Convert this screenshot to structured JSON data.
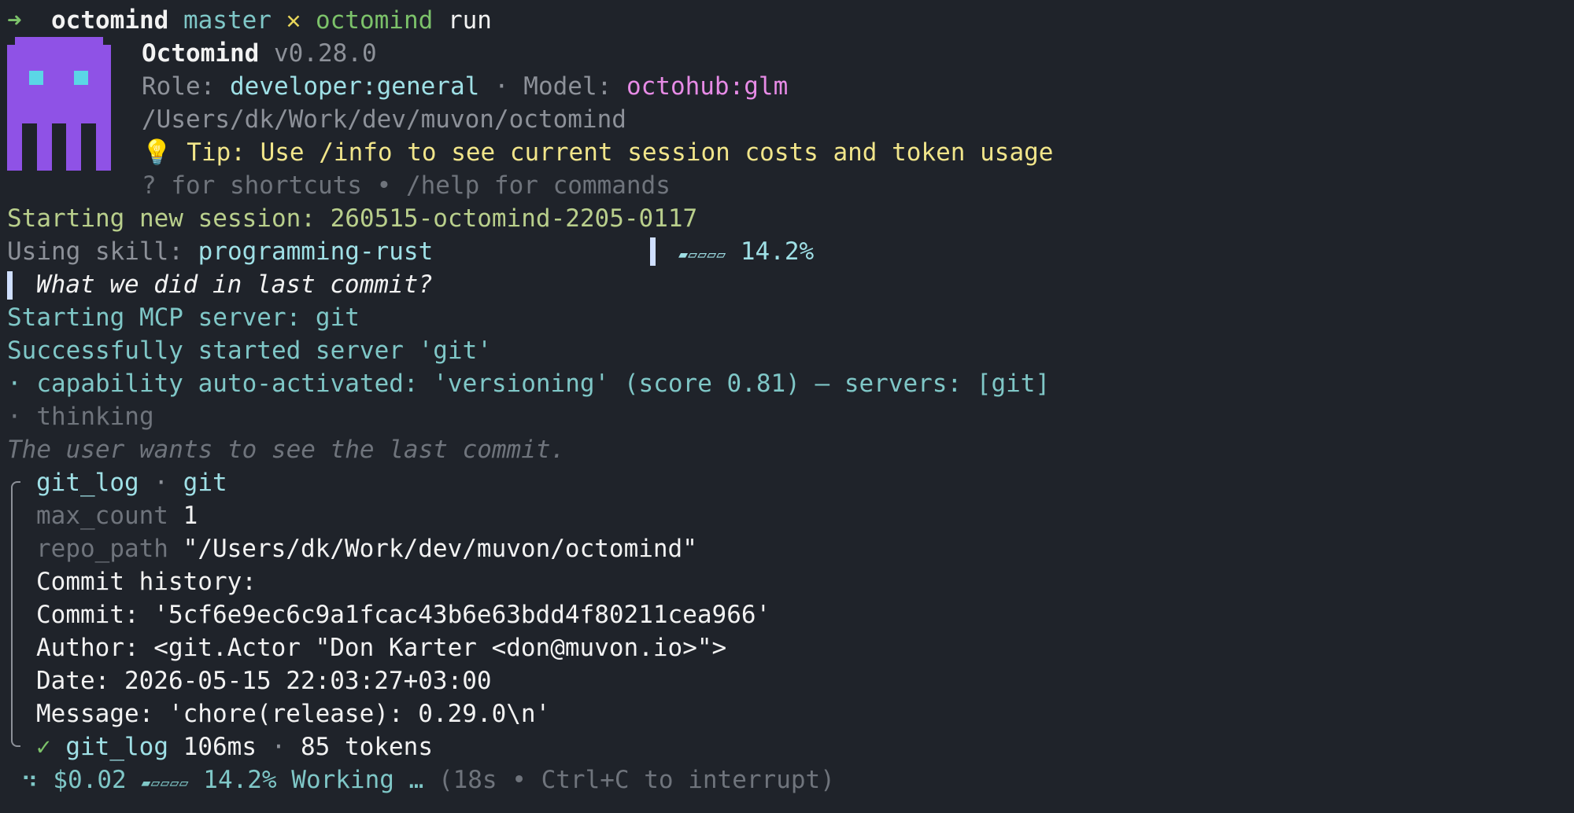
{
  "prompt": {
    "arrow": "➜",
    "cwd": "octomind",
    "branch": "master",
    "dirty": "✕",
    "command": "octomind",
    "arg": "run"
  },
  "header": {
    "app_name": "Octomind",
    "version": "v0.28.0",
    "role_label": "Role:",
    "role_value": "developer:general",
    "separator": "·",
    "model_label": "Model:",
    "model_value": "octohub:glm",
    "path": "/Users/dk/Work/dev/muvon/octomind",
    "tip_icon": "💡",
    "tip_text": "Tip: Use /info to see current session costs and token usage",
    "shortcuts_hint": "? for shortcuts • /help for commands"
  },
  "session": {
    "starting_label": "Starting new session:",
    "session_id": "260515-octomind-2205-0117",
    "skill_label": "Using skill:",
    "skill_value": "programming-rust",
    "context_meter": "▰▱▱▱▱",
    "context_percent": "14.2%"
  },
  "user_message": "What we did in last commit?",
  "log": {
    "mcp_start": "Starting MCP server: git",
    "mcp_success": "Successfully started server 'git'",
    "capability": "· capability auto-activated: 'versioning' (score 0.81) — servers: [git]",
    "thinking": "· thinking",
    "thought": "The user wants to see the last commit."
  },
  "tool_call": {
    "name": "git_log",
    "sep": "·",
    "server": "git",
    "params": [
      {
        "key": "max_count",
        "value": "1"
      },
      {
        "key": "repo_path",
        "value": "\"/Users/dk/Work/dev/muvon/octomind\""
      }
    ],
    "output": [
      "Commit history:",
      "Commit: '5cf6e9ec6c9a1fcac43b6e63bdd4f80211cea966'",
      "Author: <git.Actor \"Don Karter <don@muvon.io>\">",
      "Date: 2026-05-15 22:03:27+03:00",
      "Message: 'chore(release): 0.29.0\\n'"
    ],
    "done_icon": "✓",
    "done_name": "git_log",
    "duration": "106ms",
    "tokens": "85 tokens"
  },
  "status_bar": {
    "spinner": "⠲",
    "cost": "$0.02",
    "meter": "▰▱▱▱▱",
    "percent": "14.2%",
    "state": "Working …",
    "hint": "(18s • Ctrl+C to interrupt)"
  },
  "colors": {
    "background": "#1f232a",
    "logo_purple": "#8f52e6",
    "logo_eyes": "#5bd6e6"
  }
}
